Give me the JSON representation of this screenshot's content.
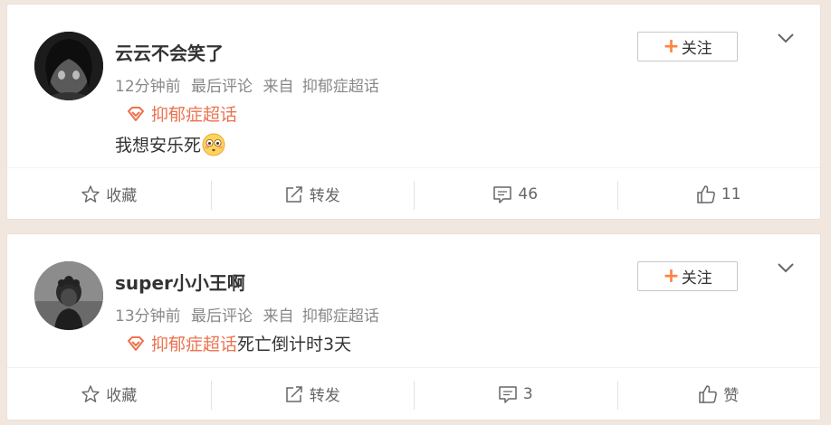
{
  "posts": [
    {
      "username": "云云不会笑了",
      "time": "12分钟前",
      "last_comment": "最后评论",
      "source_prefix": "来自",
      "source": "抑郁症超话",
      "topic": "抑郁症超话",
      "text": "我想安乐死",
      "follow_label": "关注",
      "actions": {
        "favorite": "收藏",
        "repost": "转发",
        "comment": "46",
        "like": "11"
      }
    },
    {
      "username": "super小小王啊",
      "time": "13分钟前",
      "last_comment": "最后评论",
      "source_prefix": "来自",
      "source": "抑郁症超话",
      "topic": "抑郁症超话",
      "text": "死亡倒计时3天",
      "follow_label": "关注",
      "actions": {
        "favorite": "收藏",
        "repost": "转发",
        "comment": "3",
        "like": "赞"
      }
    }
  ],
  "icons": {
    "topic": "supertopic-diamond-icon",
    "emoji": "flushed-face-emoji",
    "follow": "plus-icon",
    "menu": "chevron-down-icon",
    "favorite": "star-icon",
    "repost": "repost-icon",
    "comment": "comment-icon",
    "like": "thumbs-up-icon"
  },
  "colors": {
    "accent": "#eb7350",
    "plus": "#ff8140",
    "background": "#f2e7df"
  }
}
